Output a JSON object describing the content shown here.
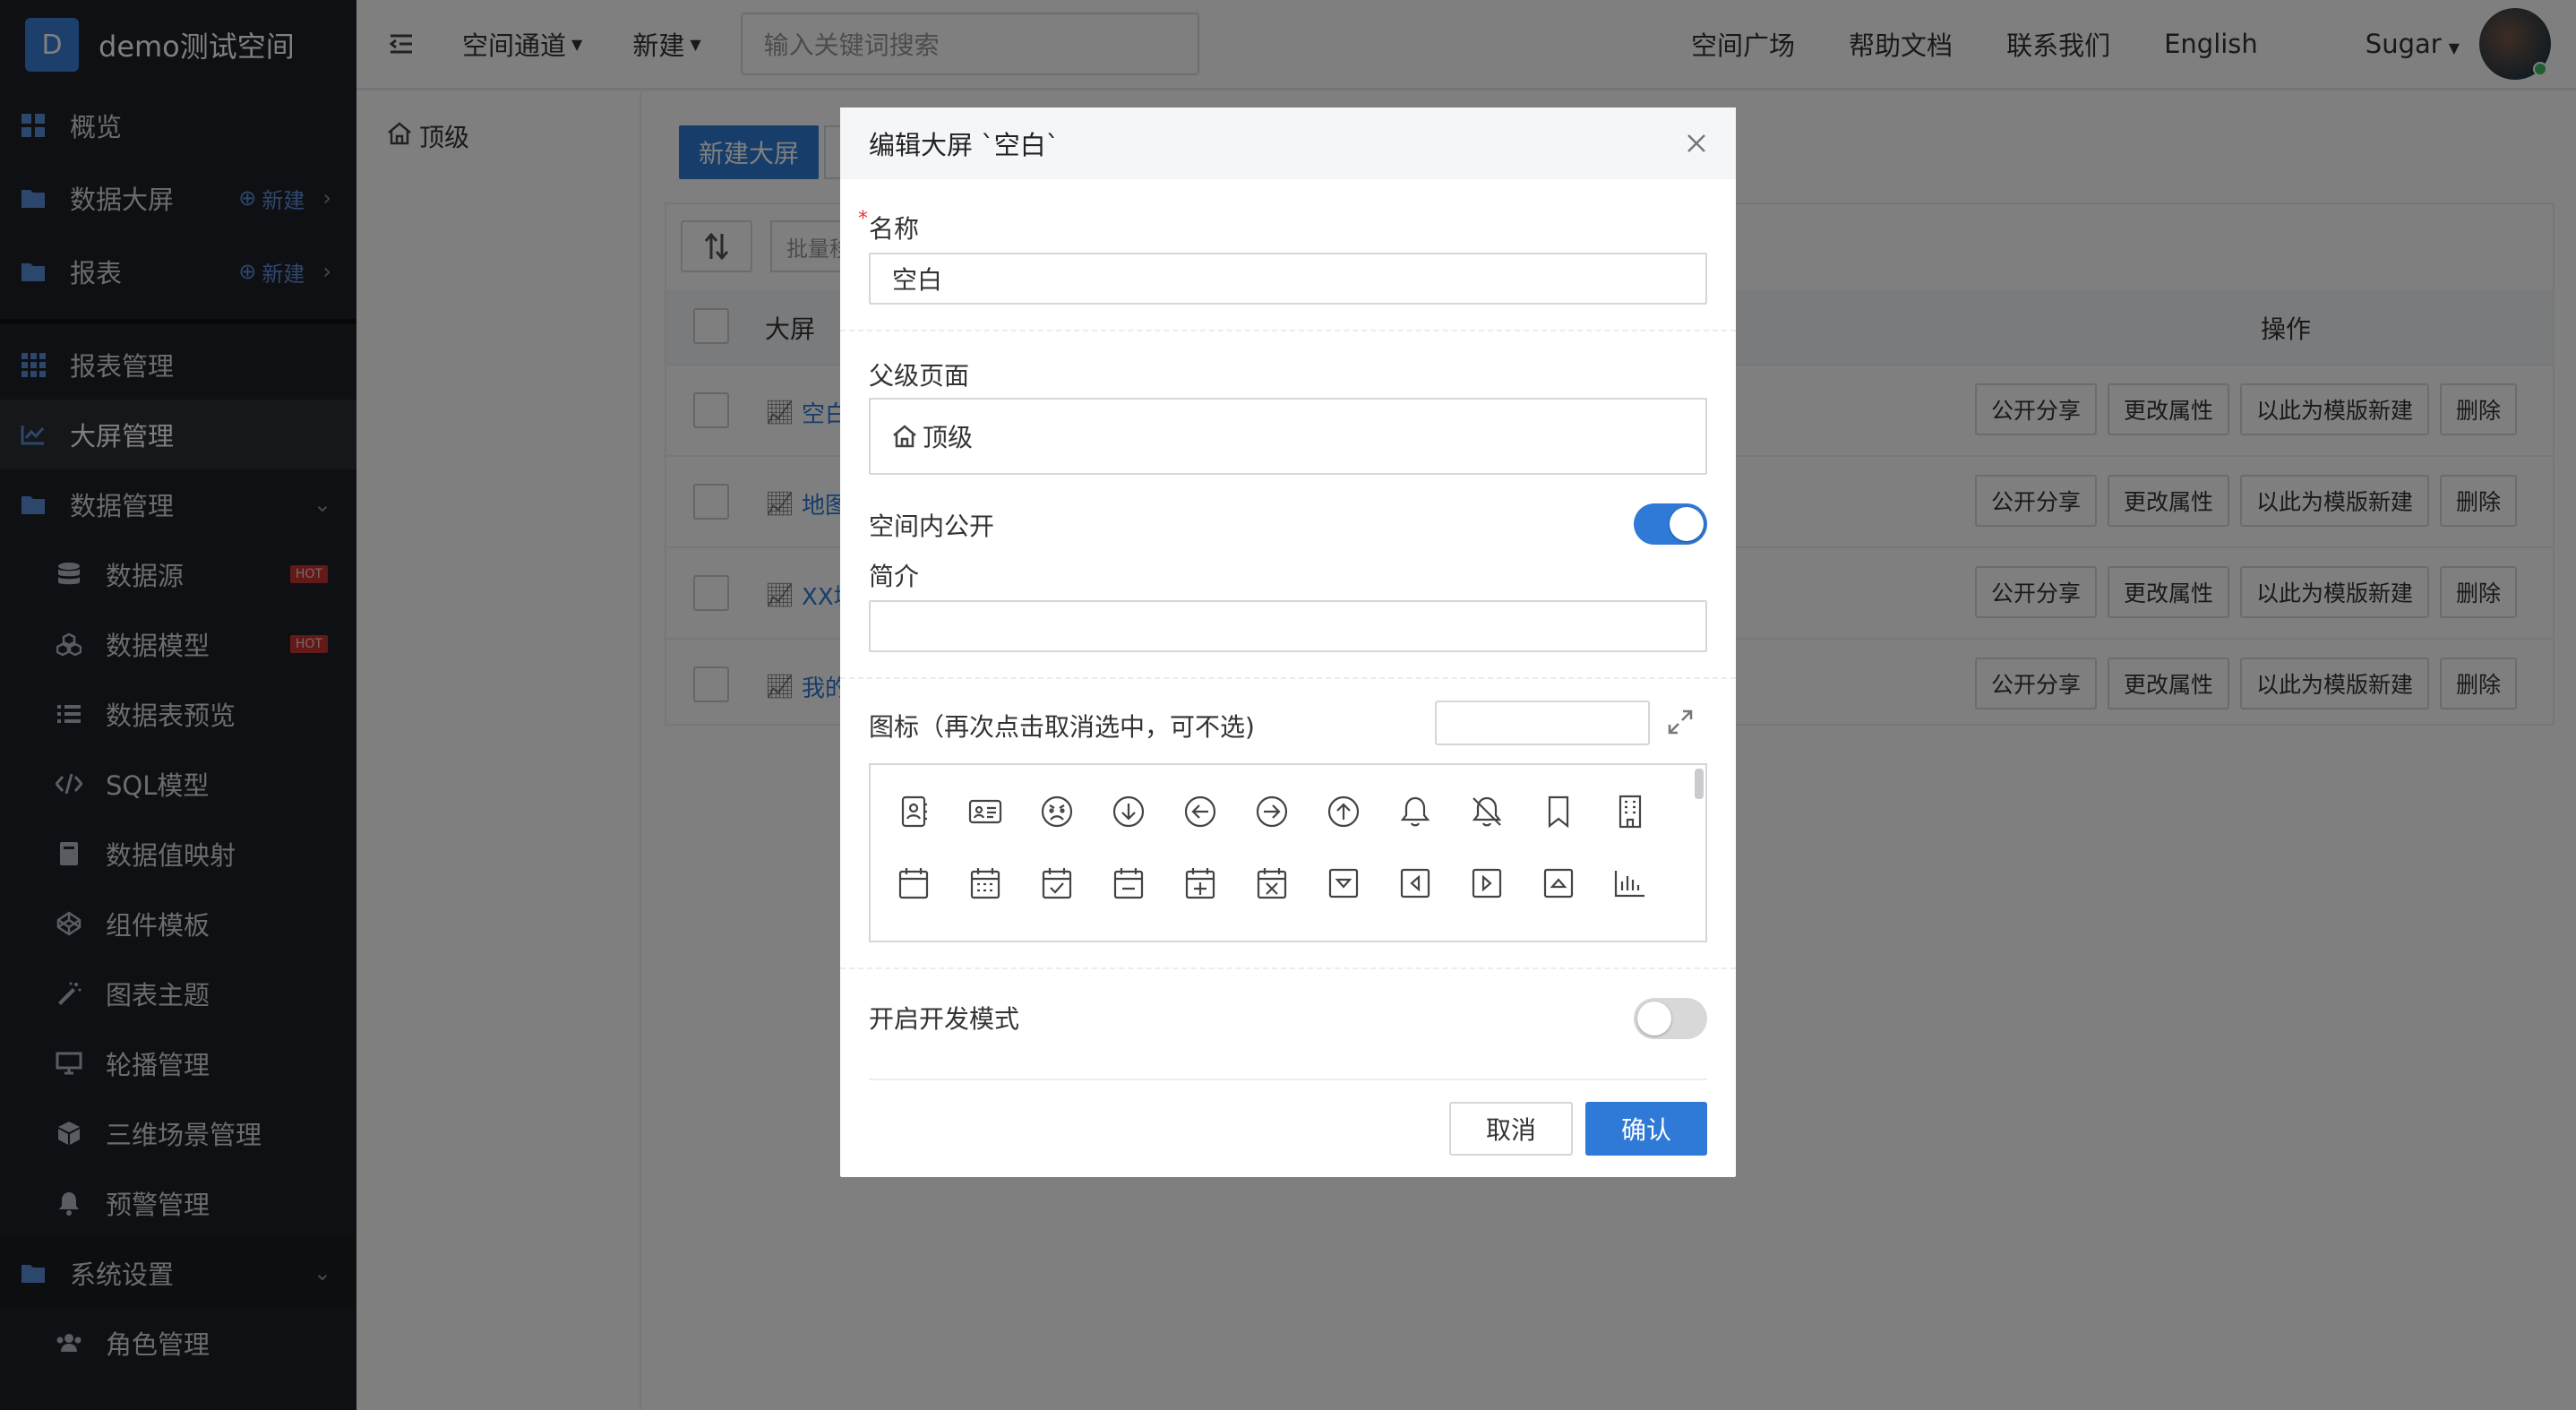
{
  "brand": {
    "logo_letter": "D",
    "title": "demo测试空间"
  },
  "sidebar": {
    "items": [
      {
        "label": "概览"
      },
      {
        "label": "数据大屏",
        "new": "新建"
      },
      {
        "label": "报表",
        "new": "新建"
      },
      {
        "label": "报表管理"
      },
      {
        "label": "大屏管理"
      },
      {
        "label": "数据管理"
      },
      {
        "label": "数据源",
        "badge": "HOT"
      },
      {
        "label": "数据模型",
        "badge": "HOT"
      },
      {
        "label": "数据表预览"
      },
      {
        "label": "SQL模型"
      },
      {
        "label": "数据值映射"
      },
      {
        "label": "组件模板"
      },
      {
        "label": "图表主题"
      },
      {
        "label": "轮播管理"
      },
      {
        "label": "三维场景管理"
      },
      {
        "label": "预警管理"
      },
      {
        "label": "系统设置"
      },
      {
        "label": "角色管理"
      }
    ]
  },
  "header": {
    "menu1": "空间通道",
    "menu2": "新建",
    "search_placeholder": "输入关键词搜索",
    "link1": "空间广场",
    "link2": "帮助文档",
    "link3": "联系我们",
    "link4": "English",
    "user": "Sugar"
  },
  "tree": {
    "root": "顶级"
  },
  "main": {
    "new_button": "新建大屏",
    "batch": "批量移",
    "col_name": "大屏",
    "col_actions": "操作",
    "rows": [
      {
        "name": "空白"
      },
      {
        "name": "地图"
      },
      {
        "name": "XX城"
      },
      {
        "name": "我的"
      }
    ],
    "actions": {
      "share": "公开分享",
      "edit": "更改属性",
      "template": "以此为模版新建",
      "delete": "删除"
    }
  },
  "modal": {
    "title": "编辑大屏 `空白`",
    "name_label": "名称",
    "name_value": "空白",
    "parent_label": "父级页面",
    "parent_value": "顶级",
    "public_label": "空间内公开",
    "public_on": true,
    "desc_label": "简介",
    "desc_value": "",
    "icon_label": "图标（再次点击取消选中，可不选)",
    "dev_label": "开启开发模式",
    "dev_on": false,
    "cancel": "取消",
    "confirm": "确认"
  },
  "colors": {
    "primary": "#2f7ad6",
    "sidebar_bg": "#1f2126",
    "hot": "#c7332e"
  }
}
